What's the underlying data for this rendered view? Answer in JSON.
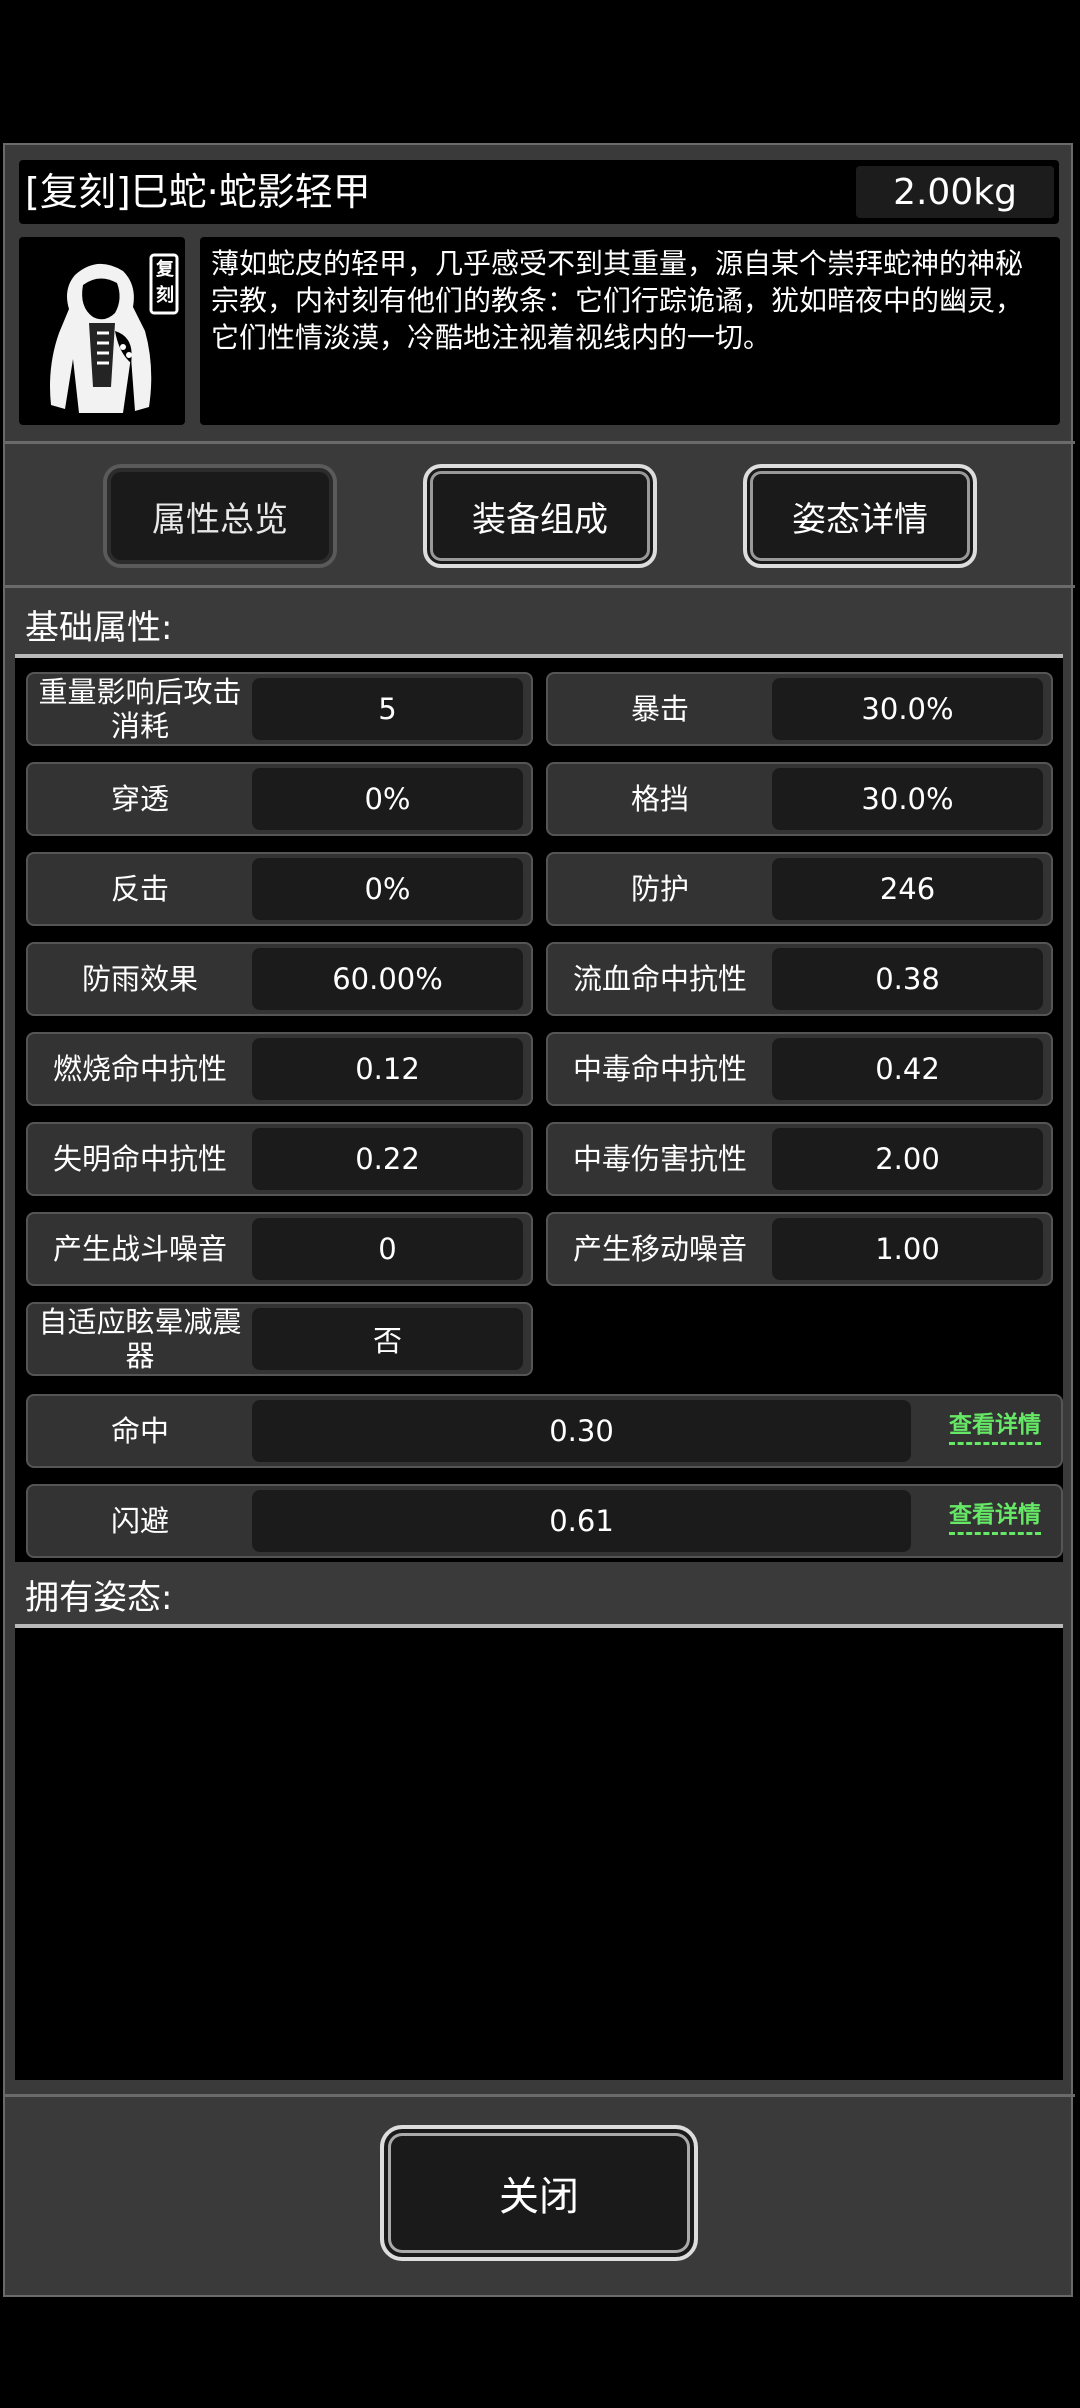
{
  "item": {
    "title": "[复刻]巳蛇·蛇影轻甲",
    "weight": "2.00kg",
    "icon_badge": "复刻",
    "description": "薄如蛇皮的轻甲，几乎感受不到其重量，源自某个崇拜蛇神的神秘宗教，内衬刻有他们的教条：它们行踪诡谲，犹如暗夜中的幽灵，它们性情淡漠，冷酷地注视着视线内的一切。"
  },
  "tabs": [
    {
      "label": "属性总览",
      "selected": true
    },
    {
      "label": "装备组成",
      "selected": false
    },
    {
      "label": "姿态详情",
      "selected": false
    }
  ],
  "basic_section": {
    "title": "基础属性:",
    "stats": [
      {
        "label": "重量影响后攻击消耗",
        "value": "5"
      },
      {
        "label": "暴击",
        "value": "30.0%"
      },
      {
        "label": "穿透",
        "value": "0%"
      },
      {
        "label": "格挡",
        "value": "30.0%"
      },
      {
        "label": "反击",
        "value": "0%"
      },
      {
        "label": "防护",
        "value": "246"
      },
      {
        "label": "防雨效果",
        "value": "60.00%"
      },
      {
        "label": "流血命中抗性",
        "value": "0.38"
      },
      {
        "label": "燃烧命中抗性",
        "value": "0.12"
      },
      {
        "label": "中毒命中抗性",
        "value": "0.42"
      },
      {
        "label": "失明命中抗性",
        "value": "0.22"
      },
      {
        "label": "中毒伤害抗性",
        "value": "2.00"
      },
      {
        "label": "产生战斗噪音",
        "value": "0"
      },
      {
        "label": "产生移动噪音",
        "value": "1.00"
      },
      {
        "label": "自适应眩晕减震器",
        "value": "否"
      }
    ],
    "wide_stats": [
      {
        "label": "命中",
        "value": "0.30",
        "link": "查看详情"
      },
      {
        "label": "闪避",
        "value": "0.61",
        "link": "查看详情"
      }
    ]
  },
  "stance_section": {
    "title": "拥有姿态:"
  },
  "close_label": "关闭",
  "colors": {
    "background": "#000000",
    "panel": "#3a3a3a",
    "link_green": "#66e866"
  }
}
